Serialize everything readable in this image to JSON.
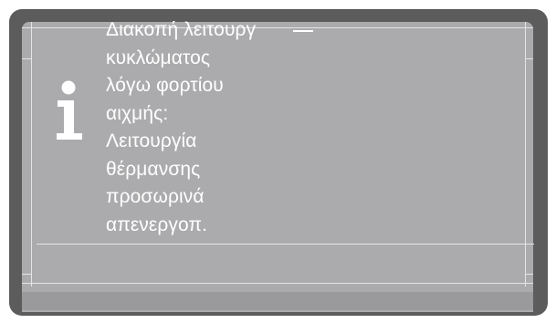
{
  "dialog": {
    "icon": "info-icon",
    "message_lines": [
      "Διακοπή λειτουργ",
      "κυκλώματος",
      "λόγω φορτίου",
      "αιχμής:",
      "Λειτουργία",
      "θέρμανσης",
      "προσωρινά",
      "απενεργοπ."
    ]
  },
  "colors": {
    "bezel": "#5c5c5c",
    "screen": "#ababad",
    "text": "#ffffff",
    "frame_lines": "#e4e4e6"
  }
}
